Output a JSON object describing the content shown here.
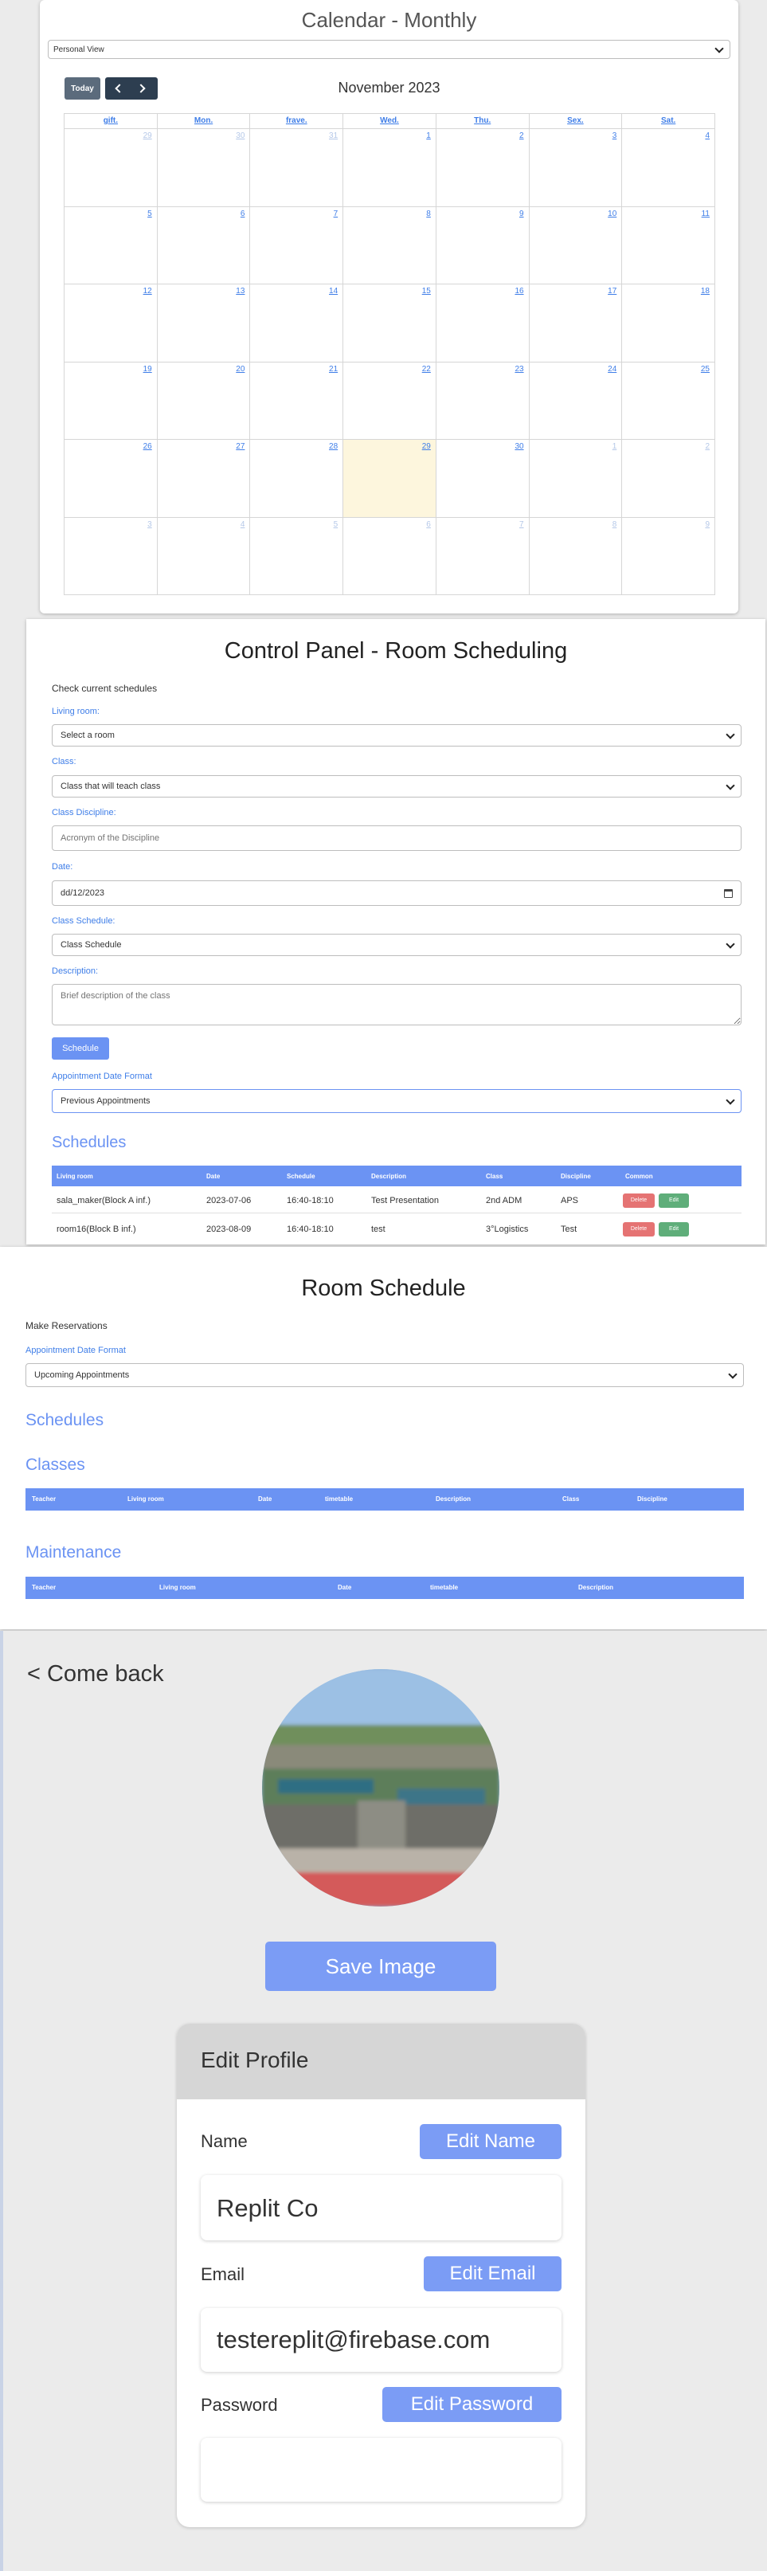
{
  "calendar": {
    "title": "Calendar - Monthly",
    "view_select": "Personal View",
    "today_label": "Today",
    "prev_icon": "chevron-left-icon",
    "next_icon": "chevron-right-icon",
    "month_label": "November 2023",
    "weekdays": [
      "gift.",
      "Mon.",
      "frave.",
      "Wed.",
      "Thu.",
      "Sex.",
      "Sat."
    ],
    "days": [
      [
        "29",
        "30",
        "31",
        "1",
        "2",
        "3",
        "4"
      ],
      [
        "5",
        "6",
        "7",
        "8",
        "9",
        "10",
        "11"
      ],
      [
        "12",
        "13",
        "14",
        "15",
        "16",
        "17",
        "18"
      ],
      [
        "19",
        "20",
        "21",
        "22",
        "23",
        "24",
        "25"
      ],
      [
        "26",
        "27",
        "28",
        "29",
        "30",
        "1",
        "2"
      ],
      [
        "3",
        "4",
        "5",
        "6",
        "7",
        "8",
        "9"
      ]
    ],
    "highlight_color": "#fdf6dd"
  },
  "control": {
    "title": "Control Panel - Room Scheduling",
    "subtitle": "Check current schedules",
    "living_room_label": "Living room:",
    "living_room_value": "Select a room",
    "class_label": "Class:",
    "class_value": "Class that will teach class",
    "discipline_label": "Class Discipline:",
    "discipline_placeholder": "Acronym of the Discipline",
    "date_label": "Date:",
    "date_value": "dd/12/2023",
    "schedule_label": "Class Schedule:",
    "schedule_value": "Class Schedule",
    "description_label": "Description:",
    "description_placeholder": "Brief description of the class",
    "schedule_button": "Schedule",
    "format_label": "Appointment Date Format",
    "format_value": "Previous Appointments",
    "schedules_heading": "Schedules",
    "columns": [
      "Living room",
      "Date",
      "Schedule",
      "Description",
      "Class",
      "Discipline",
      "Common"
    ],
    "rows": [
      {
        "room": "sala_maker(Block A inf.)",
        "date": "2023-07-06",
        "time": "16:40-18:10",
        "desc": "Test Presentation",
        "class": "2nd ADM",
        "disc": "APS",
        "delete": "Delete",
        "edit": "Edit"
      },
      {
        "room": "room16(Block B inf.)",
        "date": "2023-08-09",
        "time": "16:40-18:10",
        "desc": "test",
        "class": "3°Logistics",
        "disc": "Test",
        "delete": "Delete",
        "edit": "Edit"
      }
    ],
    "accent": "#6b93f3",
    "delete_color": "#e57373",
    "edit_color": "#5fae7a"
  },
  "room": {
    "title": "Room Schedule",
    "subtitle": "Make Reservations",
    "format_label": "Appointment Date Format",
    "format_value": "Upcoming Appointments",
    "schedules_heading": "Schedules",
    "classes_heading": "Classes",
    "classes_columns": [
      "Teacher",
      "Living room",
      "Date",
      "timetable",
      "Description",
      "Class",
      "Discipline"
    ],
    "maintenance_heading": "Maintenance",
    "maintenance_columns": [
      "Teacher",
      "Living room",
      "Date",
      "timetable",
      "Description"
    ]
  },
  "profile": {
    "back_label": "< Come back",
    "save_image": "Save Image",
    "edit_profile_title": "Edit Profile",
    "name_label": "Name",
    "edit_name": "Edit Name",
    "name_value": "Replit Co",
    "email_label": "Email",
    "edit_email": "Edit Email",
    "email_value": "testereplit@firebase.com",
    "password_label": "Password",
    "edit_password": "Edit Password",
    "password_value": "",
    "button_color": "#7b9cf5"
  }
}
